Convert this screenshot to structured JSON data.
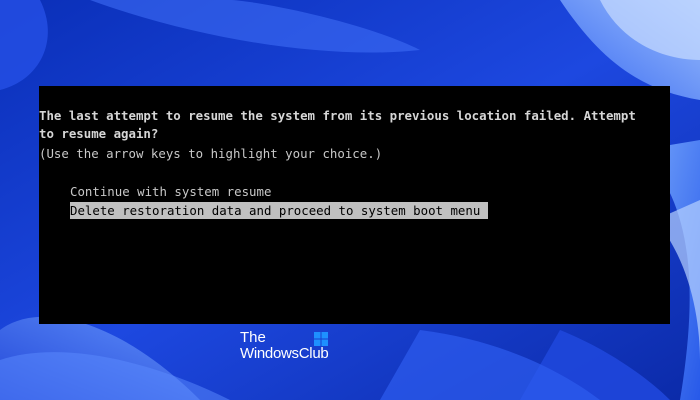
{
  "console": {
    "lines": [
      "The last attempt to resume the system from its previous location failed. Attempt",
      "to resume again?",
      "(Use the arrow keys to highlight your choice.)"
    ],
    "options": [
      {
        "label": "Continue with system resume",
        "selected": false
      },
      {
        "label": "Delete restoration data and proceed to system boot menu",
        "selected": true
      }
    ],
    "colors": {
      "background": "#000000",
      "text": "#c8c8c8",
      "highlight": "#c0c0c0"
    }
  },
  "watermark": {
    "line1": "The",
    "line2": "WindowsClub",
    "icon": "windows-logo-icon",
    "logo_color": "#1e90ff"
  },
  "wallpaper": {
    "style": "Windows 11 bloom",
    "base_color": "#1a3fd0"
  }
}
